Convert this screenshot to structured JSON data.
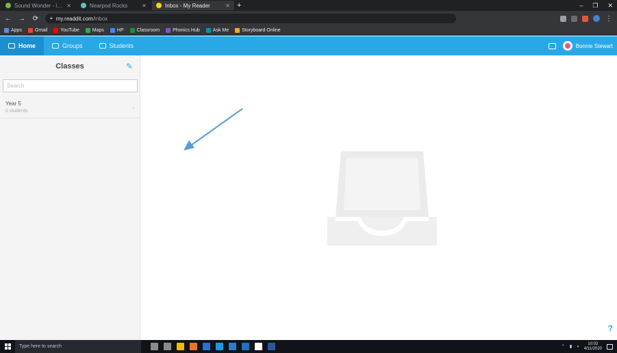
{
  "browser": {
    "tabs": [
      {
        "title": "Sound Wonder - iRSA Generator",
        "favicon_color": "#7cb342"
      },
      {
        "title": "Nearpod Rocks",
        "favicon_color": "#58c4c0"
      },
      {
        "title": "Inbox - My Reader",
        "favicon_color": "#f5d10a"
      }
    ],
    "new_tab_label": "+",
    "window_controls": [
      "–",
      "❐",
      "✕"
    ],
    "url_domain": "my.readdit.com",
    "url_path": "/inbox",
    "bookmarks": [
      {
        "label": "Apps",
        "color": "#5f8bd6"
      },
      {
        "label": "Gmail",
        "color": "#ea4335"
      },
      {
        "label": "YouTube",
        "color": "#ff0000"
      },
      {
        "label": "Maps",
        "color": "#34a853"
      },
      {
        "label": "HP",
        "color": "#4285f4"
      },
      {
        "label": "Classroom",
        "color": "#1e8e3e"
      },
      {
        "label": "Phonics Hub",
        "color": "#7e57c2"
      },
      {
        "label": "Ask Me",
        "color": "#0097a7"
      },
      {
        "label": "Storyboard Online",
        "color": "#f9a825"
      }
    ]
  },
  "app": {
    "accent": "#29a8e8",
    "nav_tabs": [
      {
        "label": "Home",
        "active": true
      },
      {
        "label": "Groups",
        "active": false
      },
      {
        "label": "Students",
        "active": false
      }
    ],
    "user_name": "Bonnie Stewart"
  },
  "sidebar": {
    "title": "Classes",
    "search_placeholder": "Search",
    "classes": [
      {
        "name": "Year 5",
        "students": "0 students"
      }
    ]
  },
  "main": {
    "empty_state_icon": "empty-inbox-tray-icon",
    "help_label": "?"
  },
  "taskbar": {
    "search_placeholder": "Type here to search",
    "clock_time": "10:02",
    "clock_date": "4/11/2020",
    "pinned": [
      "#8b8b8b",
      "#8b8b8b",
      "#f5b800",
      "#e8732a",
      "#2a6fd6",
      "#1a9ae0",
      "#2b7bd1",
      "#1e73be",
      "#ffffff",
      "#2b579a"
    ]
  }
}
